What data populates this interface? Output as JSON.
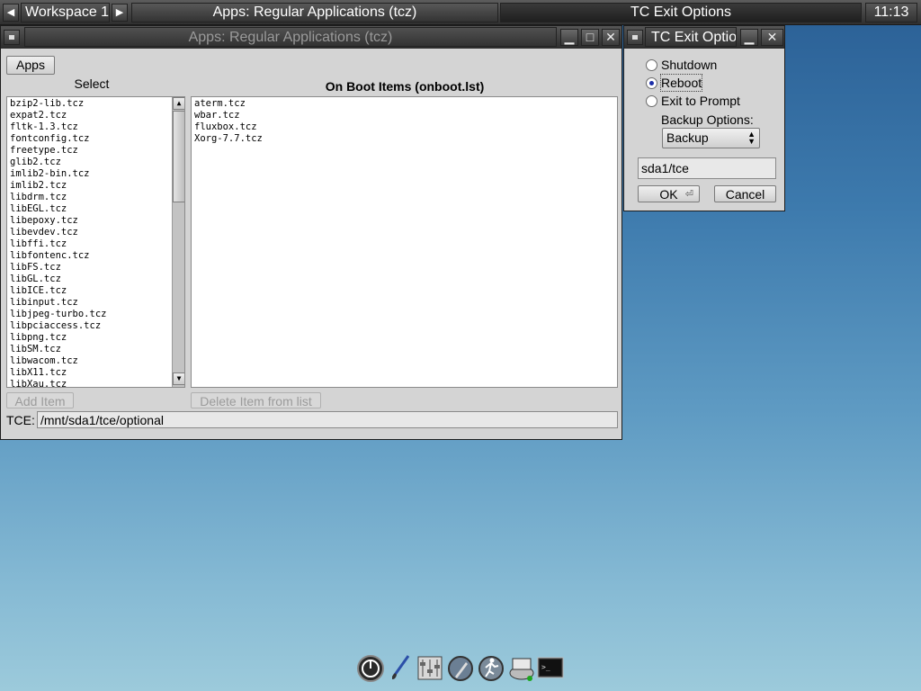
{
  "toolbar": {
    "workspace": "Workspace 1",
    "prev_arrow": "◀",
    "next_arrow": "▶",
    "tasks": [
      "Apps: Regular Applications (tcz)",
      "TC Exit Options"
    ],
    "clock": "11:13"
  },
  "apps_window": {
    "title": "Apps: Regular Applications (tcz)",
    "apps_button": "Apps",
    "select_header": "Select",
    "onboot_header": "On Boot Items (onboot.lst)",
    "select_items": [
      "bzip2-lib.tcz",
      "expat2.tcz",
      "fltk-1.3.tcz",
      "fontconfig.tcz",
      "freetype.tcz",
      "glib2.tcz",
      "imlib2-bin.tcz",
      "imlib2.tcz",
      "libdrm.tcz",
      "libEGL.tcz",
      "libepoxy.tcz",
      "libevdev.tcz",
      "libffi.tcz",
      "libfontenc.tcz",
      "libFS.tcz",
      "libGL.tcz",
      "libICE.tcz",
      "libinput.tcz",
      "libjpeg-turbo.tcz",
      "libpciaccess.tcz",
      "libpng.tcz",
      "libSM.tcz",
      "libwacom.tcz",
      "libX11.tcz",
      "libXau.tcz"
    ],
    "onboot_items": [
      "aterm.tcz",
      "wbar.tcz",
      "fluxbox.tcz",
      "Xorg-7.7.tcz"
    ],
    "add_item_button": "Add Item",
    "delete_item_button": "Delete Item from list",
    "tce_label": "TCE:",
    "tce_value": "/mnt/sda1/tce/optional"
  },
  "exit_window": {
    "title": "TC Exit Optio",
    "options": [
      "Shutdown",
      "Reboot",
      "Exit to Prompt"
    ],
    "selected_option": "Reboot",
    "backup_label": "Backup Options:",
    "backup_value": "Backup",
    "path_value": "sda1/tce",
    "ok_button": "OK",
    "cancel_button": "Cancel"
  },
  "dock": {
    "icons": [
      "power-icon",
      "paint-brush-icon",
      "control-panel-icon",
      "apps-icon",
      "run-icon",
      "mount-tool-icon",
      "terminal-icon"
    ]
  }
}
